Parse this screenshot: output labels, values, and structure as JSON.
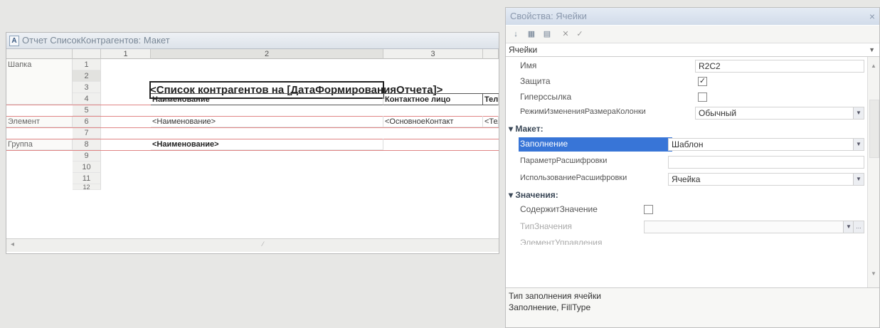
{
  "layout": {
    "title": "Отчет СписокКонтрагентов: Макет",
    "columns": [
      "1",
      "2",
      "3"
    ],
    "rows": [
      "1",
      "2",
      "3",
      "4",
      "5",
      "6",
      "7",
      "8",
      "9",
      "10",
      "11",
      "12"
    ],
    "groups": {
      "header": "Шапка",
      "element": "Элемент",
      "group": "Группа"
    },
    "report_title": "<Список контрагентов на [ДатаФормированияОтчета]>",
    "col_naim": "Наименование",
    "col_contact": "Контактное лицо",
    "col_tel": "Теле",
    "el_naim": "<Наименование>",
    "el_contact": "<ОсновноеКонтакт",
    "el_tel": "<Тел",
    "grp_naim": "<Наименование>"
  },
  "props": {
    "title": "Свойства: Ячейки",
    "close": "×",
    "selector": "Ячейки",
    "name_label": "Имя",
    "name_value": "R2C2",
    "protect_label": "Защита",
    "protect_checked": true,
    "hyperlink_label": "Гиперссылка",
    "hyperlink_checked": false,
    "colresize_label": "РежимИзмененияРазмераКолонки",
    "colresize_value": "Обычный",
    "section_layout": "Макет:",
    "fill_label": "Заполнение",
    "fill_value": "Шаблон",
    "decode_param_label": "ПараметрРасшифровки",
    "decode_param_value": "",
    "decode_use_label": "ИспользованиеРасшифровки",
    "decode_use_value": "Ячейка",
    "section_values": "Значения:",
    "contains_value_label": "СодержитЗначение",
    "contains_value_checked": false,
    "value_type_label": "ТипЗначения",
    "control_label": "ЭлементУправления",
    "desc_line1": "Тип заполнения ячейки",
    "desc_line2": "Заполнение, FillType"
  },
  "icons": {
    "sort": "sort-icon",
    "grid": "grid-icon",
    "filter": "filter-icon",
    "delete": "delete-icon",
    "check": "check-icon"
  },
  "colors": {
    "selection": "#3875d7",
    "group_line": "#e08585"
  }
}
